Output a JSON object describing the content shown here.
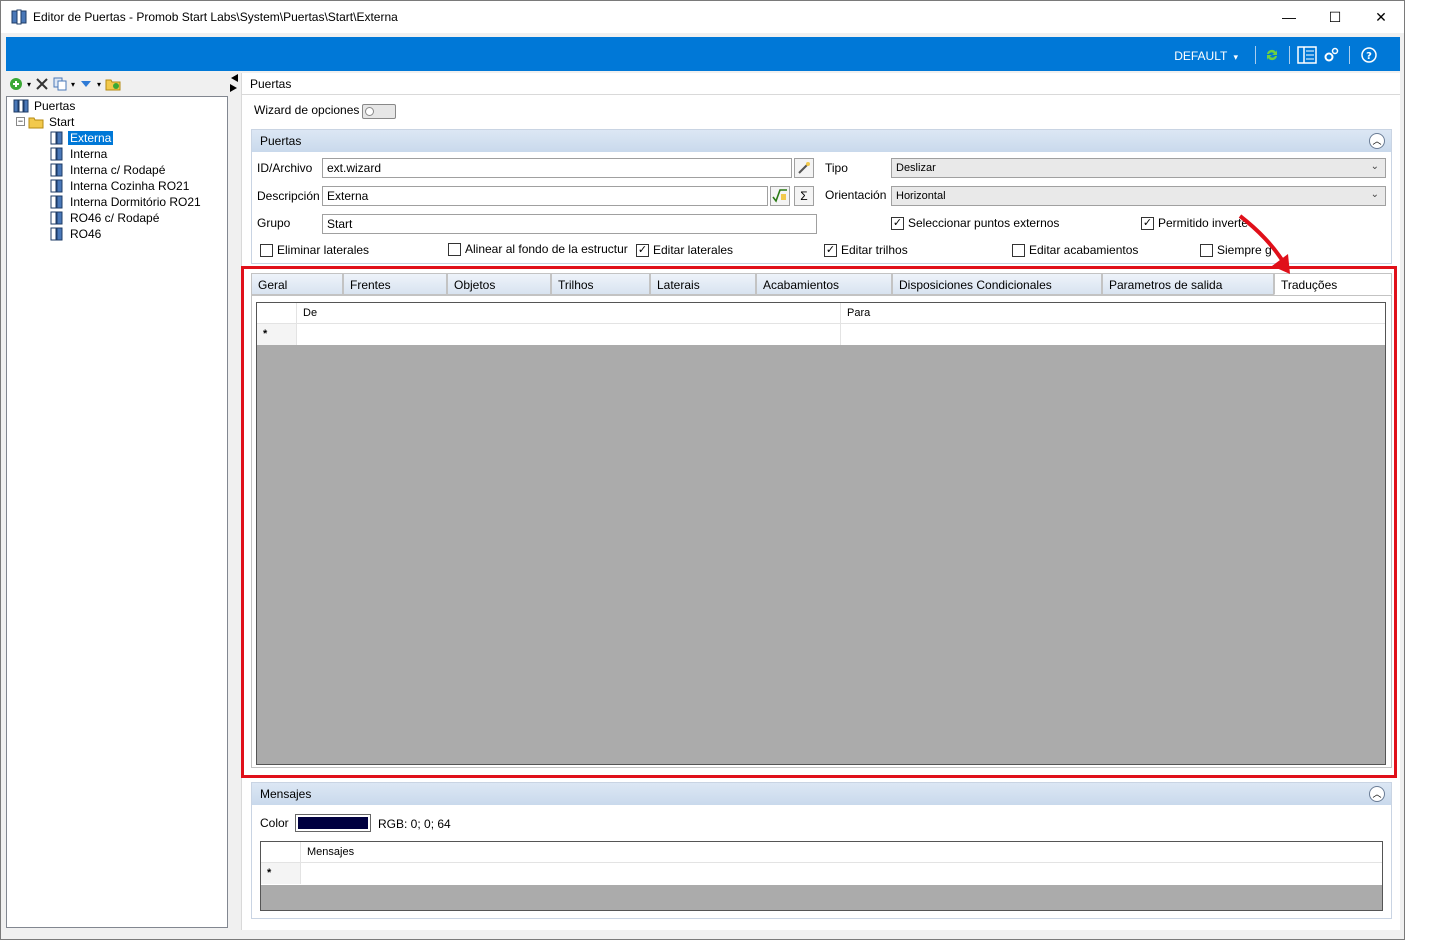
{
  "window": {
    "title": "Editor de Puertas - Promob Start Labs\\System\\Puertas\\Start\\Externa",
    "minimize": "—",
    "maximize": "☐",
    "close": "✕"
  },
  "toolbar": {
    "profile": "DEFAULT",
    "profile_arrow": "▾",
    "icons": [
      "refresh-icon",
      "list-view-icon",
      "settings-icon",
      "help-icon"
    ]
  },
  "tree": {
    "root": "Puertas",
    "folder": "Start",
    "items": [
      {
        "label": "Externa",
        "selected": true
      },
      {
        "label": "Interna"
      },
      {
        "label": "Interna c/ Rodapé"
      },
      {
        "label": "Interna Cozinha RO21"
      },
      {
        "label": "Interna Dormitório RO21"
      },
      {
        "label": "RO46 c/ Rodapé"
      },
      {
        "label": "RO46"
      }
    ]
  },
  "panel": {
    "header": "Puertas",
    "wizard_label": "Wizard de opciones"
  },
  "puertas_group": {
    "title": "Puertas",
    "id_label": "ID/Archivo",
    "id_value": "ext.wizard",
    "desc_label": "Descripción",
    "desc_value": "Externa",
    "grupo_label": "Grupo",
    "grupo_value": "Start",
    "tipo_label": "Tipo",
    "tipo_value": "Deslizar",
    "orient_label": "Orientación",
    "orient_value": "Horizontal",
    "sigma": "Σ",
    "checks": [
      {
        "label": "Seleccionar puntos externos",
        "checked": true
      },
      {
        "label": "Permitido inverte",
        "checked": true
      },
      {
        "label": "Eliminar laterales",
        "checked": false
      },
      {
        "label": "Alinear al fondo de la estructur",
        "checked": false
      },
      {
        "label": "Editar laterales",
        "checked": true
      },
      {
        "label": "Editar trilhos",
        "checked": true
      },
      {
        "label": "Editar acabamientos",
        "checked": false
      },
      {
        "label": "Siempre g",
        "checked": false
      }
    ]
  },
  "tabs": [
    {
      "label": "Geral"
    },
    {
      "label": "Frentes"
    },
    {
      "label": "Objetos"
    },
    {
      "label": "Trilhos"
    },
    {
      "label": "Laterais"
    },
    {
      "label": "Acabamientos"
    },
    {
      "label": "Disposiciones Condicionales"
    },
    {
      "label": "Parametros de salida"
    },
    {
      "label": "Traduções",
      "active": true
    }
  ],
  "trans_grid": {
    "col_de": "De",
    "col_para": "Para",
    "new_row_marker": "*"
  },
  "mensajes_group": {
    "title": "Mensajes",
    "color_label": "Color",
    "color_value": "#000040",
    "rgb_text": "RGB: 0; 0; 64",
    "col": "Mensajes",
    "new_row_marker": "*"
  },
  "colors": {
    "accent": "#0078d7",
    "annotation": "#e0101a"
  }
}
